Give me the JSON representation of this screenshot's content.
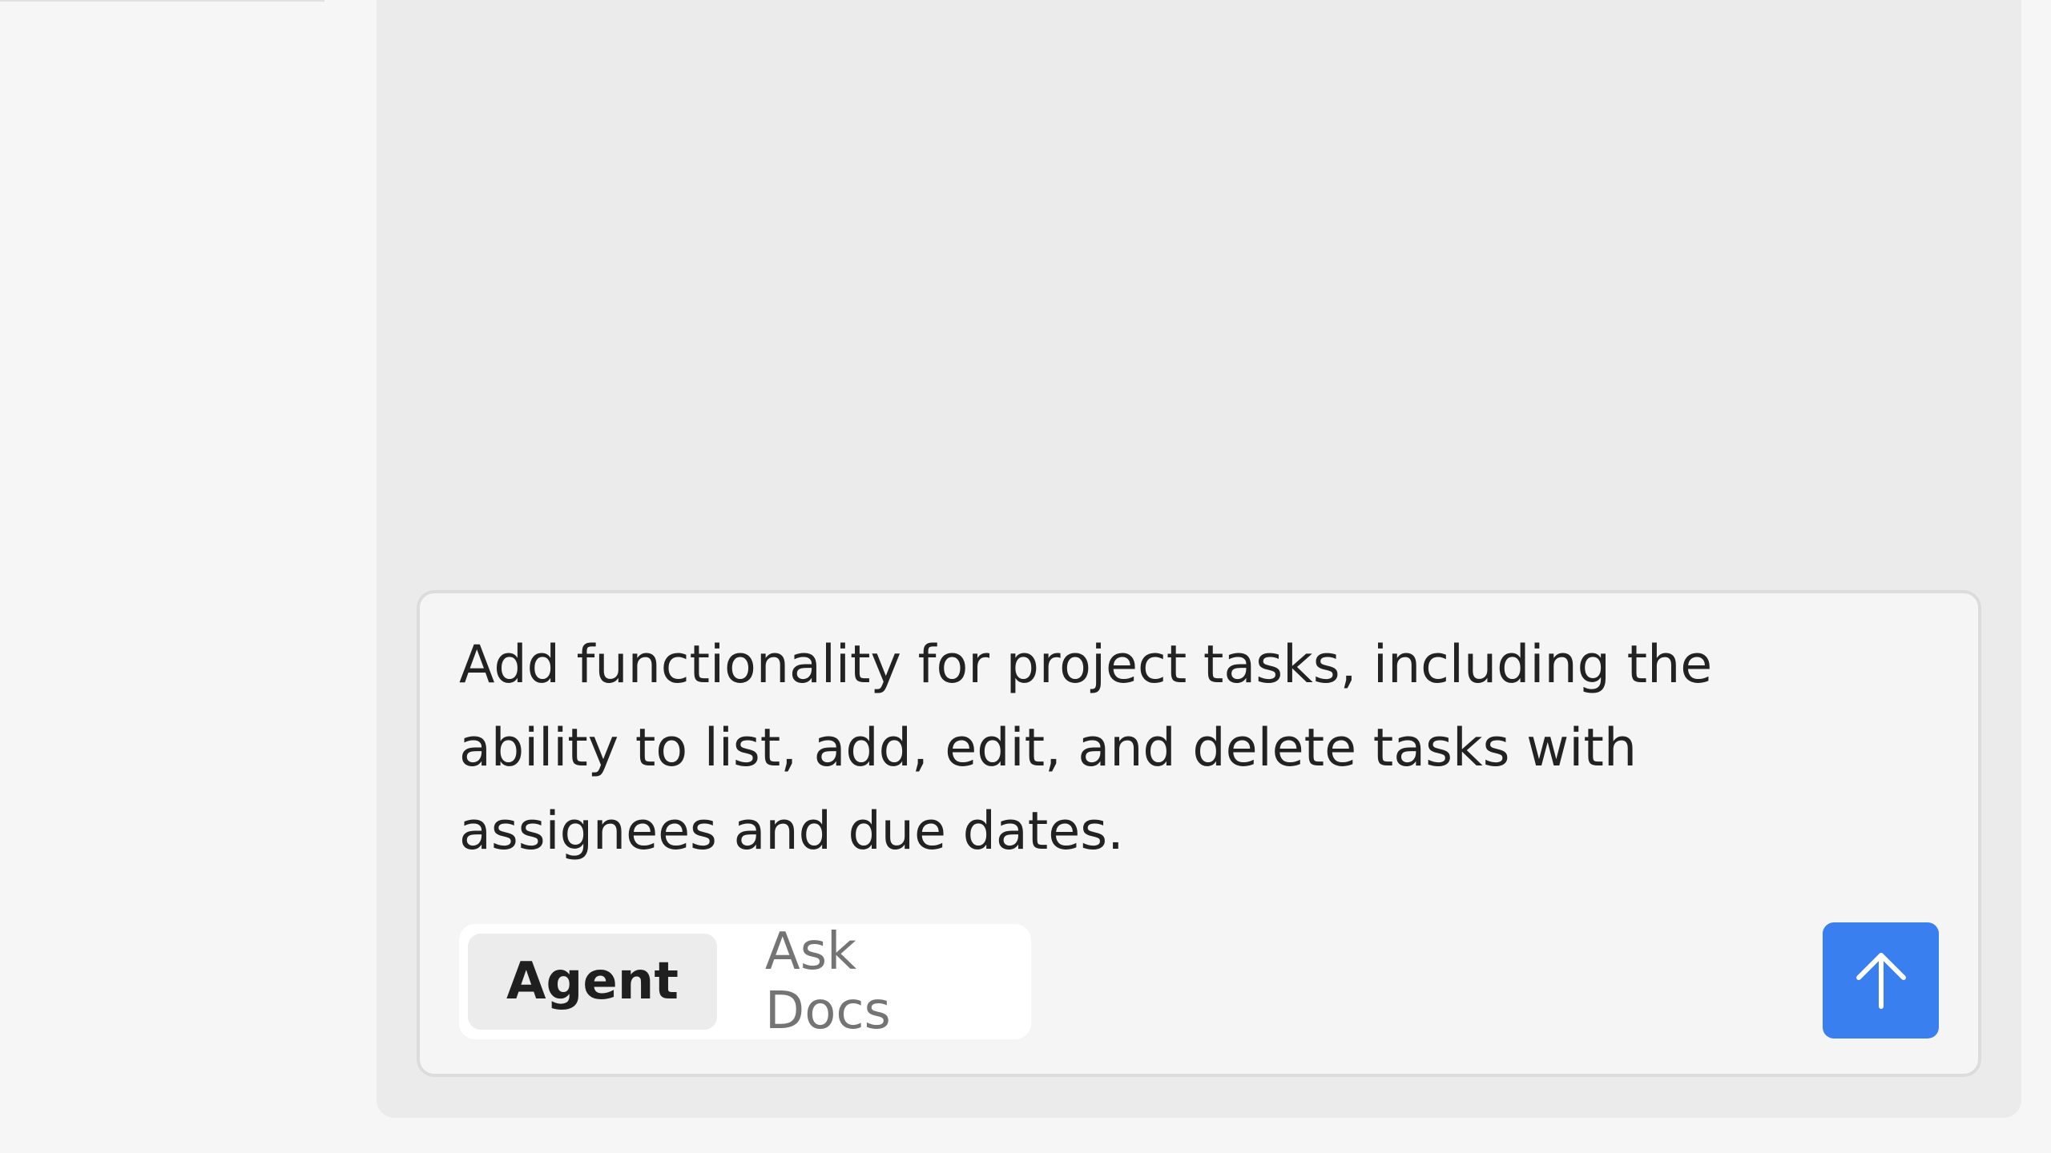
{
  "composer": {
    "text": "Add functionality for project tasks, including the ability to list, add, edit, and delete tasks with assignees and due dates.",
    "modes": [
      {
        "label": "Agent",
        "active": true
      },
      {
        "label": "Ask Docs",
        "active": false
      }
    ],
    "send_icon": "arrow-up-icon",
    "send_color": "#3a7ff0"
  }
}
